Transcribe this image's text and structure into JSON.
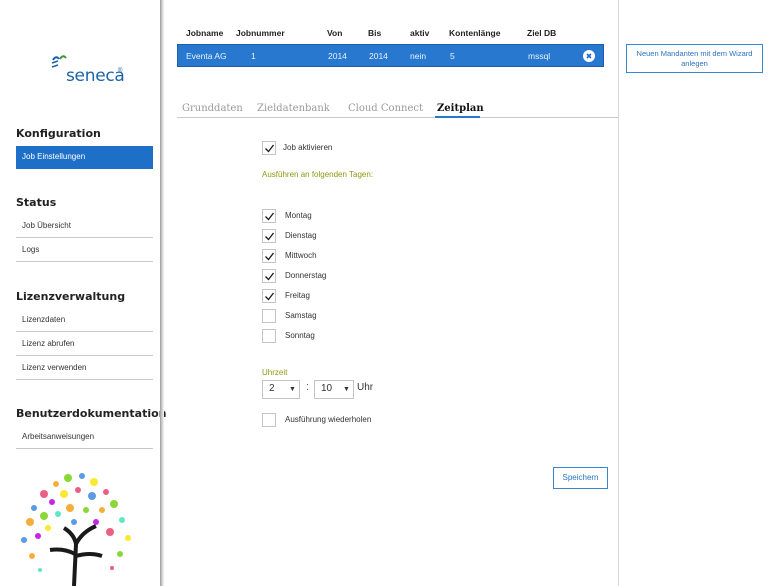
{
  "logo": {
    "text": "seneca",
    "mark": "®"
  },
  "sidebar": {
    "sections": [
      {
        "title": "Konfiguration",
        "items": [
          {
            "label": "Job Einstellungen",
            "active": true
          }
        ]
      },
      {
        "title": "Status",
        "items": [
          {
            "label": "Job Übersicht"
          },
          {
            "label": "Logs"
          }
        ]
      },
      {
        "title": "Lizenzverwaltung",
        "items": [
          {
            "label": "Lizenzdaten"
          },
          {
            "label": "Lizenz abrufen"
          },
          {
            "label": "Lizenz verwenden"
          }
        ]
      },
      {
        "title": "Benutzerdokumentation",
        "items": [
          {
            "label": "Arbeitsanweisungen"
          }
        ]
      }
    ]
  },
  "job_table": {
    "columns": [
      "Jobname",
      "Jobnummer",
      "Von",
      "Bis",
      "aktiv",
      "Kontenlänge",
      "Ziel DB"
    ],
    "rows": [
      [
        "Eventa AG",
        "1",
        "2014",
        "2014",
        "nein",
        "5",
        "mssql"
      ]
    ]
  },
  "tabs": [
    {
      "label": "Grunddaten"
    },
    {
      "label": "Zieldatenbank"
    },
    {
      "label": "Cloud Connect"
    },
    {
      "label": "Zeitplan",
      "active": true
    }
  ],
  "wizard_button": {
    "label": "Neuen Mandanten mit dem Wizard anlegen"
  },
  "form": {
    "job_activate": {
      "label": "Job aktivieren",
      "checked": true
    },
    "days_heading": "Ausführen an folgenden Tagen:",
    "days": [
      {
        "label": "Montag",
        "checked": true
      },
      {
        "label": "Dienstag",
        "checked": true
      },
      {
        "label": "Mittwoch",
        "checked": true
      },
      {
        "label": "Donnerstag",
        "checked": true
      },
      {
        "label": "Freitag",
        "checked": true
      },
      {
        "label": "Samstag",
        "checked": false
      },
      {
        "label": "Sonntag",
        "checked": false
      }
    ],
    "time_label": "Uhrzeit",
    "hour": "2",
    "minute": "10",
    "time_separator": ":",
    "time_unit": "Uhr",
    "repeat": {
      "label": "Ausführung wiederholen",
      "checked": false
    },
    "save_label": "Speichern"
  },
  "colors": {
    "accent": "#2878d0",
    "accent_text": "#2a72c2",
    "olive_text": "#8a9a10"
  }
}
